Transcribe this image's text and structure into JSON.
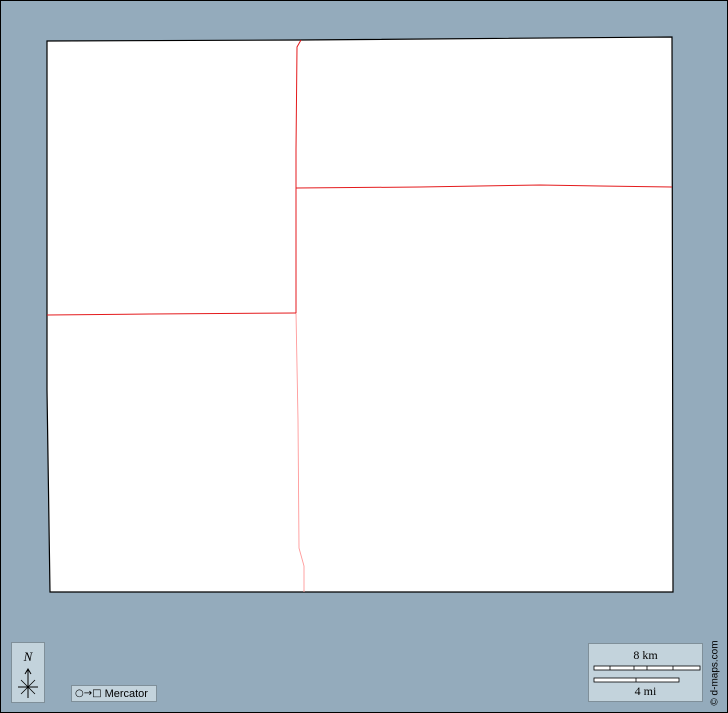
{
  "map": {
    "background_color": "#94abbc",
    "land_color": "#ffffff",
    "boundary_color": "#e41a1c",
    "outline_color": "#000000"
  },
  "compass": {
    "north_label": "N",
    "icon": "north-arrow-icon"
  },
  "projection": {
    "symbol": "○→□",
    "label": "Mercator"
  },
  "scale": {
    "km_label": "8 km",
    "mi_label": "4 mi"
  },
  "credit": "© d-maps.com"
}
